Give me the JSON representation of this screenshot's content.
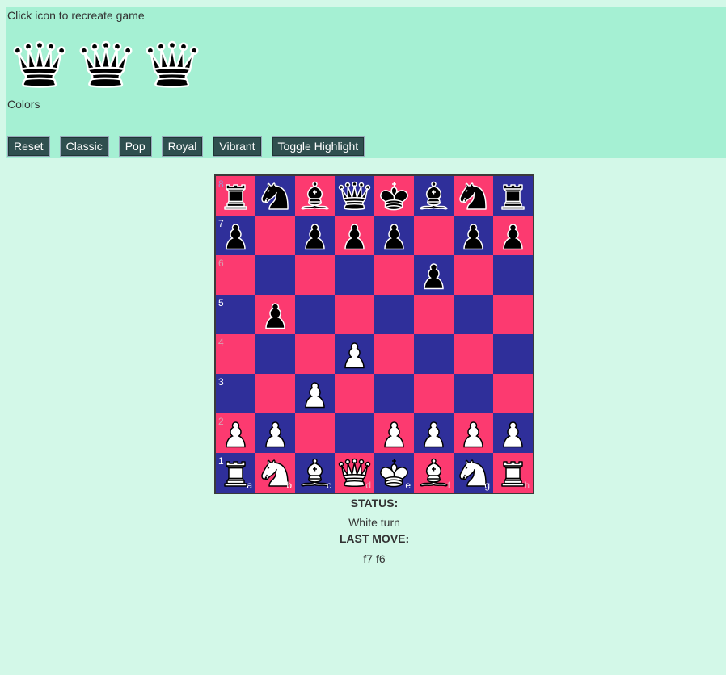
{
  "header": {
    "hint": "Click icon to recreate game",
    "icons": [
      "queen-icon",
      "queen-icon",
      "queen-icon"
    ],
    "colors_label": "Colors",
    "buttons": [
      "Reset",
      "Classic",
      "Pop",
      "Royal",
      "Vibrant",
      "Toggle Highlight"
    ]
  },
  "board": {
    "theme": {
      "light": "#fc3a70",
      "dark": "#2f2f9a"
    },
    "ranks": [
      "8",
      "7",
      "6",
      "5",
      "4",
      "3",
      "2",
      "1"
    ],
    "files": [
      "a",
      "b",
      "c",
      "d",
      "e",
      "f",
      "g",
      "h"
    ],
    "rank_label_colors": [
      "#9a8fd0",
      "#ffffff",
      "#d8a0b0",
      "#ffffff",
      "#d8a0b0",
      "#ffffff",
      "#d8a0b0",
      "#ffffff"
    ],
    "file_label_colors": [
      "#ffffff",
      "#ffffff",
      "#ffffff",
      "#e8b0c0",
      "#ffffff",
      "#e8b0c0",
      "#ffffff",
      "#e8b0c0"
    ],
    "position": [
      [
        "bR",
        "bN",
        "bB",
        "bQ",
        "bK",
        "bB",
        "bN",
        "bR"
      ],
      [
        "bP",
        "",
        "bP",
        "bP",
        "bP",
        "",
        "bP",
        "bP"
      ],
      [
        "",
        "",
        "",
        "",
        "",
        "bP",
        "",
        ""
      ],
      [
        "",
        "bP",
        "",
        "",
        "",
        "",
        "",
        ""
      ],
      [
        "",
        "",
        "",
        "wP",
        "",
        "",
        "",
        ""
      ],
      [
        "",
        "",
        "wP",
        "",
        "",
        "",
        "",
        ""
      ],
      [
        "wP",
        "wP",
        "",
        "",
        "wP",
        "wP",
        "wP",
        "wP"
      ],
      [
        "wR",
        "wN",
        "wB",
        "wQ",
        "wK",
        "wB",
        "wN",
        "wR"
      ]
    ]
  },
  "status": {
    "status_label": "STATUS:",
    "status_value": "White turn",
    "last_move_label": "LAST MOVE:",
    "last_move_value": "f7 f6"
  }
}
